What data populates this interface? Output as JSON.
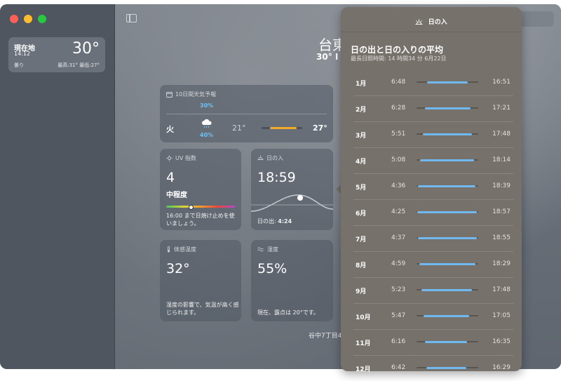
{
  "sidebar": {
    "location": {
      "name": "現在地",
      "time": "14:12",
      "temp": "30°",
      "condition": "曇り",
      "hilo": "最高:31° 最低:27°"
    }
  },
  "main": {
    "city": "台東",
    "city_sub": "30° I",
    "address": "谷中7丁目4",
    "forecast": {
      "title": "10日間天気予報",
      "prev_pct": "30%",
      "day": "火",
      "rain": "40%",
      "low": "21°",
      "high": "27°",
      "bar_start_frac": 0.2,
      "bar_end_frac": 0.86
    },
    "uv": {
      "title": "UV 指数",
      "value": "4",
      "level": "中程度",
      "marker_frac": 0.36,
      "desc": "16:00 まで日焼け止めを使いましょう。"
    },
    "sunset": {
      "title": "日の入",
      "value": "18:59",
      "sunrise_label": "日の出:",
      "sunrise_value": "4:24"
    },
    "feels": {
      "title": "体感温度",
      "value": "32°",
      "desc": "湿度の影響で、気温が高く感じられます。"
    },
    "humidity": {
      "title": "湿度",
      "value": "55%",
      "desc": "現在、露点は 20°です。"
    }
  },
  "popover": {
    "header": "日の入",
    "title": "日の出と日の入りの平均",
    "subtitle": "最長日照時間: 14 時間34 分 6月22日",
    "months": [
      {
        "month": "1月",
        "rise": "6:48",
        "set": "16:51",
        "start": 0.17,
        "end": 0.83
      },
      {
        "month": "2月",
        "rise": "6:28",
        "set": "17:21",
        "start": 0.14,
        "end": 0.87
      },
      {
        "month": "3月",
        "rise": "5:51",
        "set": "17:48",
        "start": 0.1,
        "end": 0.9
      },
      {
        "month": "4月",
        "rise": "5:08",
        "set": "18:14",
        "start": 0.06,
        "end": 0.93
      },
      {
        "month": "5月",
        "rise": "4:36",
        "set": "18:39",
        "start": 0.02,
        "end": 0.96
      },
      {
        "month": "6月",
        "rise": "4:25",
        "set": "18:57",
        "start": 0.01,
        "end": 0.98
      },
      {
        "month": "7月",
        "rise": "4:37",
        "set": "18:55",
        "start": 0.02,
        "end": 0.98
      },
      {
        "month": "8月",
        "rise": "4:59",
        "set": "18:29",
        "start": 0.05,
        "end": 0.95
      },
      {
        "month": "9月",
        "rise": "5:23",
        "set": "17:48",
        "start": 0.08,
        "end": 0.9
      },
      {
        "month": "10月",
        "rise": "5:47",
        "set": "17:05",
        "start": 0.11,
        "end": 0.85
      },
      {
        "month": "11月",
        "rise": "6:16",
        "set": "16:35",
        "start": 0.14,
        "end": 0.82
      },
      {
        "month": "12月",
        "rise": "6:42",
        "set": "16:29",
        "start": 0.16,
        "end": 0.81
      }
    ]
  },
  "colors": {
    "daylight_bar": "#6fb8f0",
    "temp_bar": "#f0ac28",
    "rain_text": "#6fc0f5"
  }
}
